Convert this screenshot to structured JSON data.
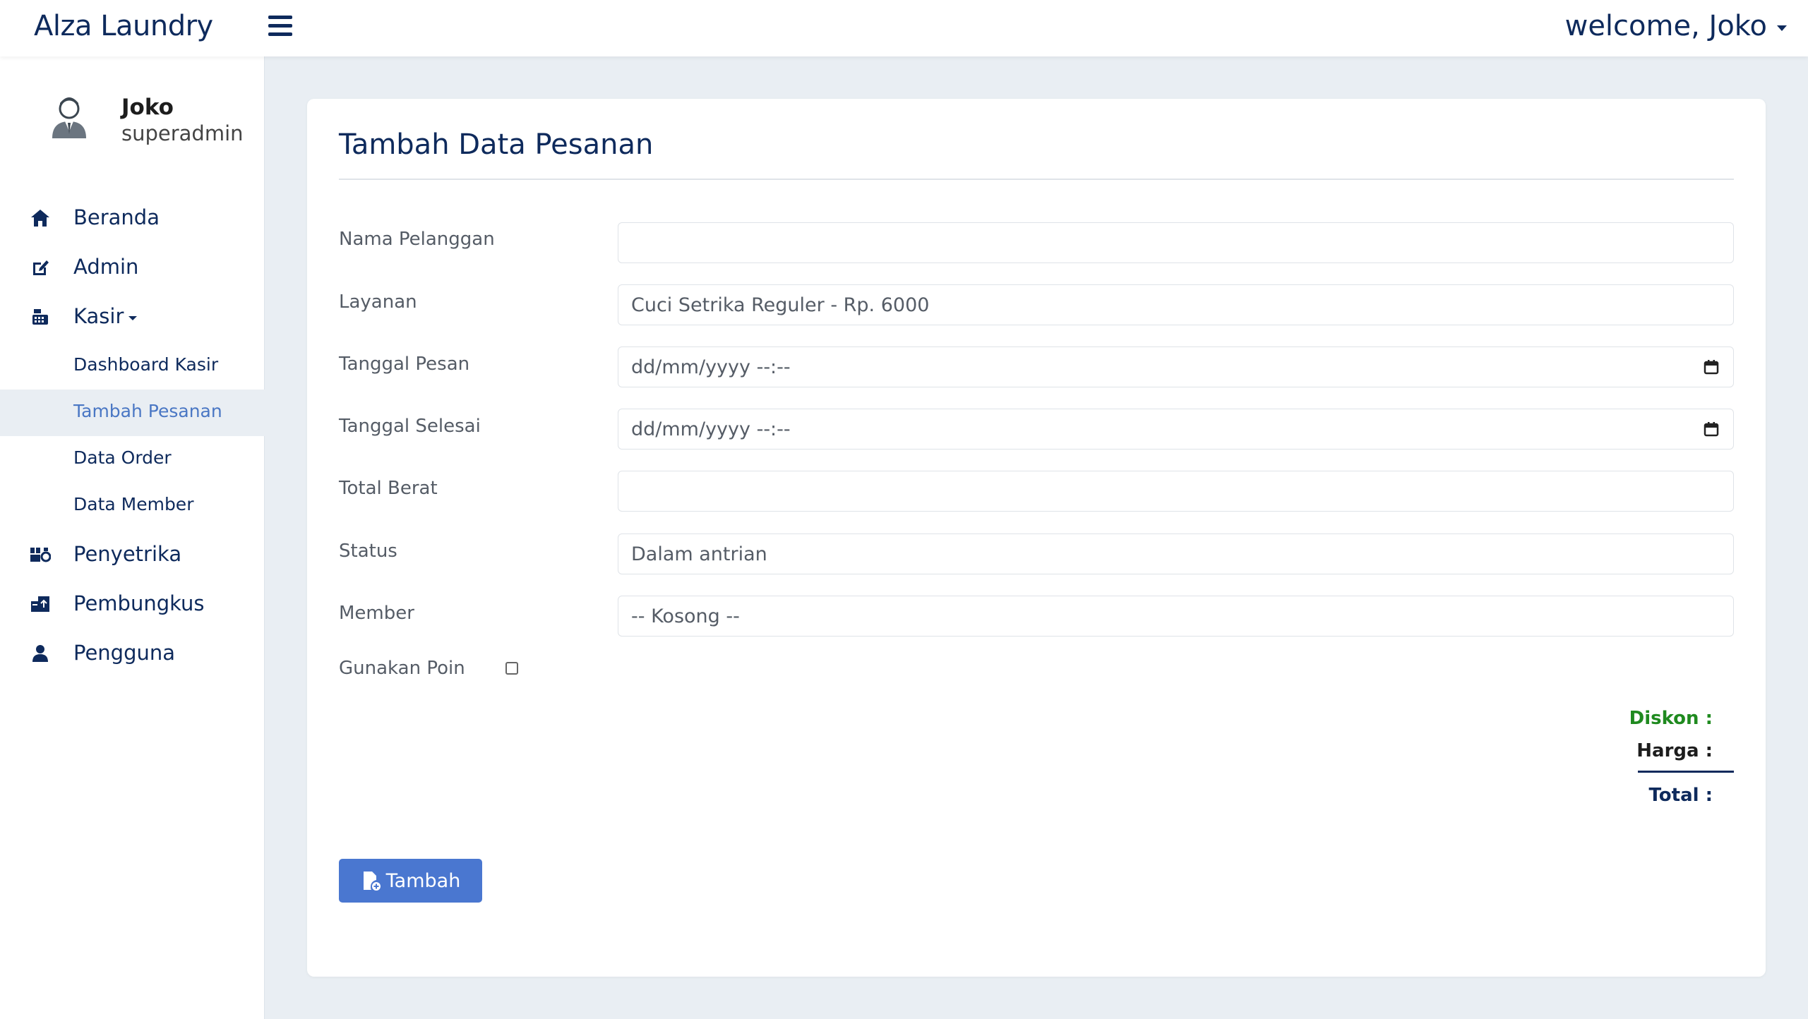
{
  "header": {
    "brand": "Alza Laundry",
    "welcome": "welcome, Joko"
  },
  "profile": {
    "name": "Joko",
    "role": "superadmin"
  },
  "sidebar": {
    "items": [
      {
        "label": "Beranda",
        "icon": "home-icon"
      },
      {
        "label": "Admin",
        "icon": "edit-icon"
      },
      {
        "label": "Kasir",
        "icon": "cash-register-icon"
      },
      {
        "label": "Penyetrika",
        "icon": "iron-icon"
      },
      {
        "label": "Pembungkus",
        "icon": "package-icon"
      },
      {
        "label": "Pengguna",
        "icon": "user-icon"
      }
    ],
    "kasir_sub": [
      {
        "label": "Dashboard Kasir"
      },
      {
        "label": "Tambah Pesanan",
        "active": true
      },
      {
        "label": "Data Order"
      },
      {
        "label": "Data Member"
      }
    ]
  },
  "form": {
    "title": "Tambah Data Pesanan",
    "fields": [
      {
        "label": "Nama Pelanggan",
        "value": ""
      },
      {
        "label": "Layanan",
        "value": "Cuci Setrika Reguler - Rp. 6000"
      },
      {
        "label": "Tanggal Pesan",
        "value": "dd/mm/yyyy --:--"
      },
      {
        "label": "Tanggal Selesai",
        "value": "dd/mm/yyyy --:--"
      },
      {
        "label": "Total Berat",
        "value": ""
      },
      {
        "label": "Status",
        "value": "Dalam antrian"
      },
      {
        "label": "Member",
        "value": "-- Kosong --"
      }
    ],
    "checkbox_label": "Gunakan Poin",
    "summary": {
      "diskon": "Diskon :",
      "harga": "Harga :",
      "total": "Total :"
    },
    "submit_label": "Tambah"
  },
  "colors": {
    "primary": "#0e2a5c",
    "button": "#4a77d0",
    "diskon": "#1f8a1f",
    "background": "#e9eef3"
  }
}
